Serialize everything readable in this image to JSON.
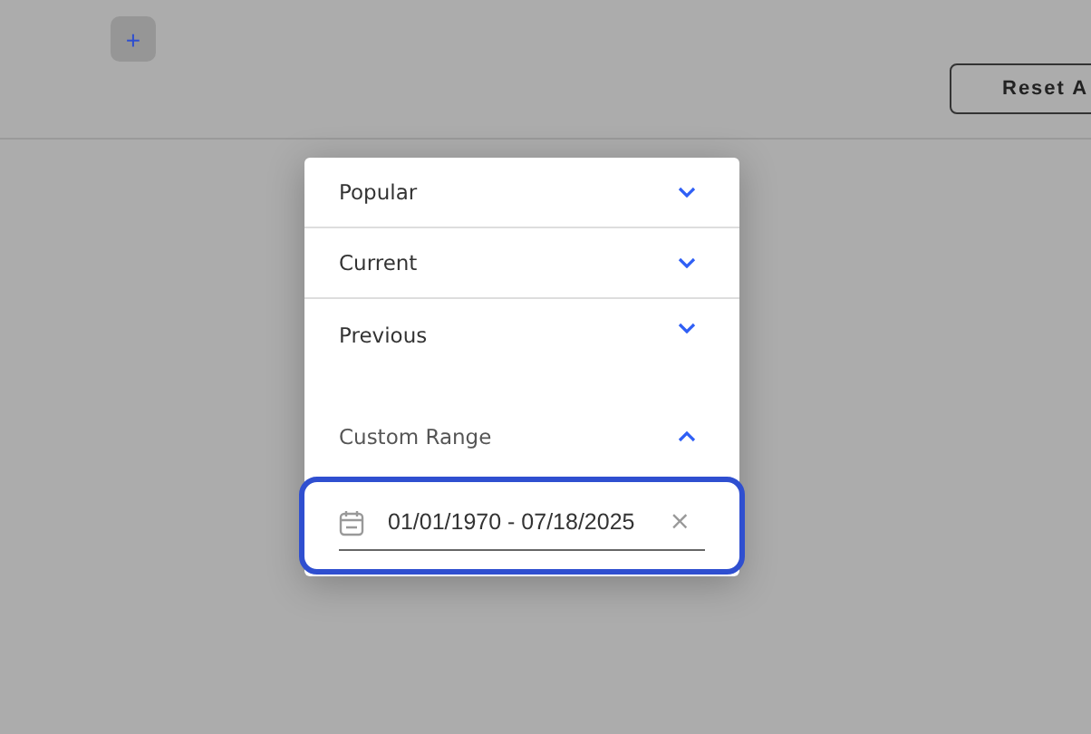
{
  "toolbar": {
    "add_button": "+",
    "reset_button": "Reset A"
  },
  "date_menu": {
    "sections": [
      {
        "label": "Popular",
        "expanded": false
      },
      {
        "label": "Current",
        "expanded": false
      },
      {
        "label": "Previous",
        "expanded": false
      },
      {
        "label": "Custom Range",
        "expanded": true
      }
    ],
    "range_field": {
      "value": "01/01/1970 - 07/18/2025",
      "clear": "×",
      "focused": true
    }
  }
}
